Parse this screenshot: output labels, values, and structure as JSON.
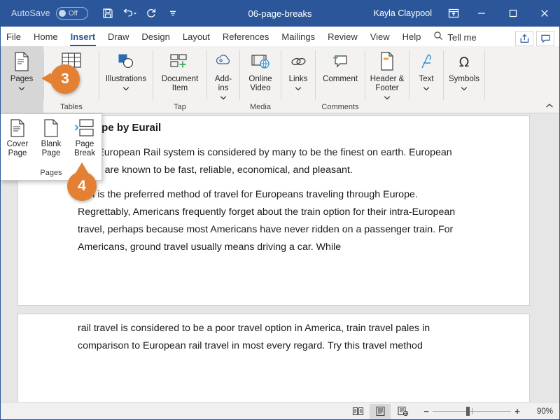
{
  "titlebar": {
    "autosave_label": "AutoSave",
    "autosave_state": "Off",
    "document_title": "06-page-breaks",
    "user_name": "Kayla Claypool",
    "quick_access": [
      {
        "name": "save-icon",
        "tooltip": "Save"
      },
      {
        "name": "undo-icon",
        "tooltip": "Undo"
      },
      {
        "name": "redo-icon",
        "tooltip": "Redo"
      },
      {
        "name": "customize-quick-access-icon",
        "tooltip": "Customize Quick Access Toolbar"
      }
    ],
    "window_controls": [
      "ribbon-display-options",
      "minimize",
      "maximize",
      "close"
    ],
    "bar_color": "#2b579a"
  },
  "tabs": [
    {
      "label": "File",
      "active": false
    },
    {
      "label": "Home",
      "active": false
    },
    {
      "label": "Insert",
      "active": true
    },
    {
      "label": "Draw",
      "active": false
    },
    {
      "label": "Design",
      "active": false
    },
    {
      "label": "Layout",
      "active": false
    },
    {
      "label": "References",
      "active": false
    },
    {
      "label": "Mailings",
      "active": false
    },
    {
      "label": "Review",
      "active": false
    },
    {
      "label": "View",
      "active": false
    },
    {
      "label": "Help",
      "active": false
    }
  ],
  "tell_me": {
    "label": "Tell me",
    "icon": "search-icon"
  },
  "tabs_right": [
    {
      "name": "share-button",
      "icon": "share-icon"
    },
    {
      "name": "comments-button",
      "icon": "comment-icon"
    }
  ],
  "ribbon": {
    "groups": [
      {
        "name": "pages",
        "label": "",
        "active": true,
        "buttons": [
          {
            "label": "Pages",
            "icon": "page-icon",
            "caret": true
          }
        ]
      },
      {
        "name": "tables",
        "label": "Tables",
        "active": false,
        "buttons": [
          {
            "label": "",
            "icon": "table-icon",
            "caret": false
          }
        ]
      },
      {
        "name": "illustrations",
        "label": "",
        "active": false,
        "buttons": [
          {
            "label": "Illustrations",
            "icon": "illustrations-icon",
            "caret": true
          }
        ]
      },
      {
        "name": "tap",
        "label": "Tap",
        "active": false,
        "buttons": [
          {
            "label": "Document\nItem",
            "icon": "document-item-icon",
            "caret": false
          }
        ]
      },
      {
        "name": "addins",
        "label": "",
        "active": false,
        "buttons": [
          {
            "label": "Add-\nins",
            "icon": "addins-icon",
            "caret": true
          }
        ]
      },
      {
        "name": "media",
        "label": "Media",
        "active": false,
        "buttons": [
          {
            "label": "Online\nVideo",
            "icon": "online-video-icon",
            "caret": false
          }
        ]
      },
      {
        "name": "links",
        "label": "",
        "active": false,
        "buttons": [
          {
            "label": "Links",
            "icon": "links-icon",
            "caret": true
          }
        ]
      },
      {
        "name": "comments",
        "label": "Comments",
        "active": false,
        "buttons": [
          {
            "label": "Comment",
            "icon": "new-comment-icon",
            "caret": false
          }
        ]
      },
      {
        "name": "header-footer",
        "label": "",
        "active": false,
        "buttons": [
          {
            "label": "Header &\nFooter",
            "icon": "header-footer-icon",
            "caret": true
          }
        ]
      },
      {
        "name": "text",
        "label": "",
        "active": false,
        "buttons": [
          {
            "label": "Text",
            "icon": "text-icon",
            "caret": true
          }
        ]
      },
      {
        "name": "symbols",
        "label": "",
        "active": false,
        "buttons": [
          {
            "label": "Symbols",
            "icon": "omega-icon",
            "caret": true
          }
        ]
      }
    ],
    "collapse_icon": "chevron-up-icon"
  },
  "pages_dropdown": {
    "group_label": "Pages",
    "items": [
      {
        "label": "Cover\nPage",
        "icon": "cover-page-icon",
        "caret": true
      },
      {
        "label": "Blank\nPage",
        "icon": "blank-page-icon",
        "caret": false
      },
      {
        "label": "Page\nBreak",
        "icon": "page-break-icon",
        "caret": false
      }
    ]
  },
  "callouts": [
    {
      "number": "3",
      "target": "pages-button",
      "color": "#e38033"
    },
    {
      "number": "4",
      "target": "page-break-item",
      "color": "#e38033"
    }
  ],
  "document": {
    "page1": {
      "heading": "Europe by Eurail",
      "paragraphs": [
        "The European Rail system is considered by many to be the finest on earth. European trains are known to be fast, reliable, economical, and pleasant.",
        "Rail is the preferred method of travel for Europeans traveling through Europe. Regrettably, Americans frequently forget about the train option for their intra-European travel, perhaps because most Americans have never ridden on a passenger train. For Americans, ground travel usually means driving a car. While"
      ]
    },
    "page2": {
      "paragraphs": [
        "rail travel is considered to be a poor travel option in America, train travel pales in comparison to European rail travel in most every regard. Try this travel method"
      ]
    }
  },
  "statusbar": {
    "views": [
      {
        "name": "read-mode-button",
        "icon": "read-mode-icon",
        "active": false
      },
      {
        "name": "print-layout-button",
        "icon": "print-layout-icon",
        "active": true
      },
      {
        "name": "web-layout-button",
        "icon": "web-layout-icon",
        "active": false
      }
    ],
    "zoom": {
      "minus": "−",
      "plus": "+",
      "percent": "90%"
    }
  }
}
